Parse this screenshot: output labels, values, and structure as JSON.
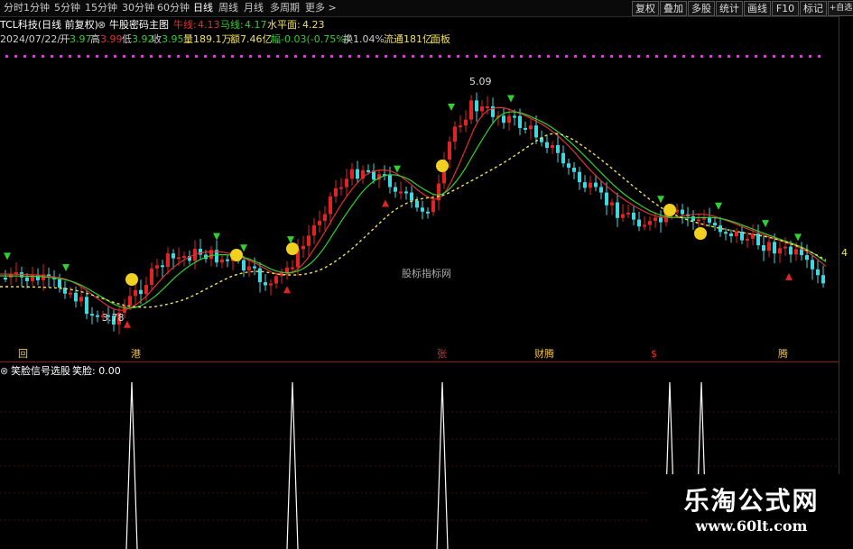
{
  "toolbar": {
    "periods": [
      "分时",
      "1分钟",
      "5分钟",
      "15分钟",
      "30分钟",
      "60分钟",
      "日线",
      "周线",
      "月线",
      "多周期",
      "更多 >"
    ],
    "active_period": "日线",
    "right_buttons": [
      "复权",
      "叠加",
      "多股",
      "统计",
      "画线",
      "F10",
      "标记",
      "+自选"
    ]
  },
  "header": {
    "title": "TCL科技(日线 前复权)",
    "indicator_name": "牛股密码主图",
    "niu_label": "牛线:",
    "niu_value": "4.13",
    "ma_label": "马线:",
    "ma_value": "4.17",
    "water_label": "水平面:",
    "water_value": "4.23"
  },
  "quote": {
    "date": "2024/07/22/一",
    "open_label": "开",
    "open": "3.97",
    "high_label": "高",
    "high": "3.99",
    "low_label": "低",
    "low": "3.92",
    "close_label": "收",
    "close": "3.95",
    "volume": "量189.1万",
    "amount": "额7.46亿",
    "change": "幅-0.03(-0.75%)",
    "turnover": "换1.04%",
    "float": "流通181亿",
    "sector": "面板"
  },
  "annotations": {
    "high_price": "5.09",
    "low_price": "3.78",
    "center_watermark": "股标指标网",
    "right_price": "4"
  },
  "bottom_tags": [
    "回",
    "港",
    "张",
    "财腾",
    "$",
    "腾"
  ],
  "sub_indicator": {
    "name": "笑脸信号选股",
    "value_label": "笑脸: 0.00"
  },
  "watermark": {
    "title": "乐淘公式网",
    "url": "www.60lt.com"
  },
  "colors": {
    "up": "#e02424",
    "down": "#40d8e0",
    "niu_line": "#e03030",
    "ma_line": "#30d030",
    "water_line": "#f0e060",
    "signal_down": "#30d030",
    "signal_up": "#e02424",
    "face": "#f0d020",
    "spike": "#ffffff",
    "dots": "#d040d0"
  }
}
